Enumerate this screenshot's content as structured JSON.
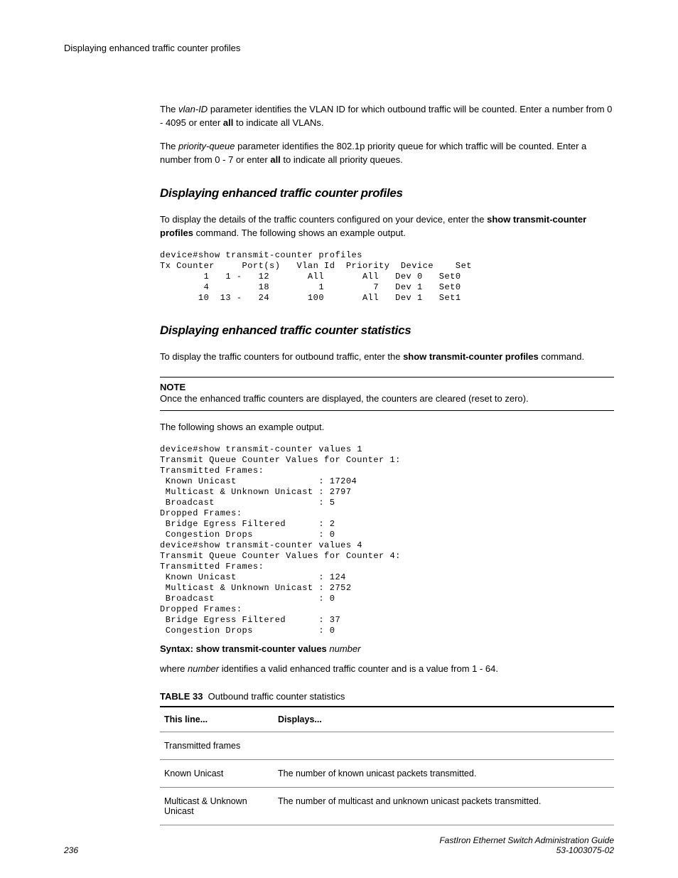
{
  "header": "Displaying enhanced traffic counter profiles",
  "intro_paras": [
    {
      "pre": "The ",
      "em": "vlan-ID",
      "post1": " parameter identifies the VLAN ID for which outbound traffic will be counted. Enter a number from 0 - 4095 or enter ",
      "bold": "all",
      "post2": " to indicate all VLANs."
    },
    {
      "pre": "The ",
      "em": "priority-queue",
      "post1": " parameter identifies the 802.1p priority queue for which traffic will be counted. Enter a number from 0 - 7 or enter ",
      "bold": "all",
      "post2": " to indicate all priority queues."
    }
  ],
  "section1": {
    "title": "Displaying enhanced traffic counter profiles",
    "para_pre": "To display the details of the traffic counters configured on your device, enter the ",
    "para_bold": "show transmit-counter profiles",
    "para_post": " command. The following shows an example output.",
    "cli": "device#show transmit-counter profiles\nTx Counter     Port(s)   Vlan Id  Priority  Device    Set\n        1   1 -   12       All       All   Dev 0   Set0\n        4         18         1         7   Dev 1   Set0\n       10  13 -   24       100       All   Dev 1   Set1"
  },
  "section2": {
    "title": "Displaying enhanced traffic counter statistics",
    "para_pre": "To display the traffic counters for outbound traffic, enter the ",
    "para_bold": "show transmit-counter profiles",
    "para_post": " command.",
    "note_label": "NOTE",
    "note_text": "Once the enhanced traffic counters are displayed, the counters are cleared (reset to zero).",
    "after_note": "The following shows an example output.",
    "cli": "device#show transmit-counter values 1\nTransmit Queue Counter Values for Counter 1:\nTransmitted Frames:\n Known Unicast               : 17204\n Multicast & Unknown Unicast : 2797\n Broadcast                   : 5\nDropped Frames:\n Bridge Egress Filtered      : 2\n Congestion Drops            : 0\ndevice#show transmit-counter values 4\nTransmit Queue Counter Values for Counter 4:\nTransmitted Frames:\n Known Unicast               : 124\n Multicast & Unknown Unicast : 2752\n Broadcast                   : 0\nDropped Frames:\n Bridge Egress Filtered      : 37\n Congestion Drops            : 0",
    "syntax_bold": "Syntax: show transmit-counter values",
    "syntax_em": " number",
    "where_pre": "where ",
    "where_em": "number",
    "where_post": " identifies a valid enhanced traffic counter and is a value from 1 - 64."
  },
  "table": {
    "label": "TABLE 33",
    "caption": "Outbound traffic counter statistics",
    "head1": "This line...",
    "head2": "Displays...",
    "rows": [
      {
        "c1": "Transmitted frames",
        "c2": ""
      },
      {
        "c1": "Known Unicast",
        "c2": "The number of known unicast packets transmitted."
      },
      {
        "c1": "Multicast & Unknown Unicast",
        "c2": "The number of multicast and unknown unicast packets transmitted."
      }
    ]
  },
  "footer": {
    "page": "236",
    "title": "FastIron Ethernet Switch Administration Guide",
    "docnum": "53-1003075-02"
  }
}
